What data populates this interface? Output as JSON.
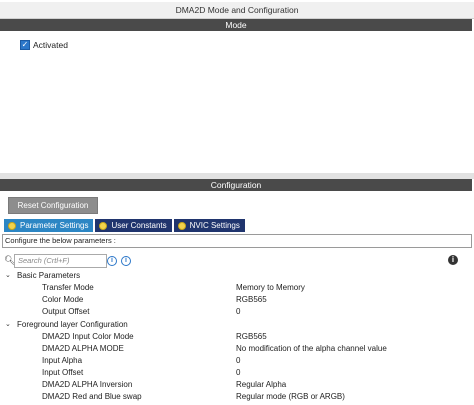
{
  "window": {
    "title": "DMA2D Mode and Configuration"
  },
  "mode": {
    "header": "Mode",
    "activated_label": "Activated",
    "activated_checked": true
  },
  "configuration": {
    "header": "Configuration",
    "reset_label": "Reset Configuration",
    "tabs": [
      {
        "label": "Parameter Settings",
        "active": true
      },
      {
        "label": "User Constants",
        "active": false
      },
      {
        "label": "NVIC Settings",
        "active": false
      }
    ],
    "description": "Configure the below parameters :",
    "search_placeholder": "Search (Crtl+F)",
    "groups": [
      {
        "name": "Basic Parameters",
        "params": [
          {
            "name": "Transfer Mode",
            "value": "Memory to Memory"
          },
          {
            "name": "Color Mode",
            "value": "RGB565"
          },
          {
            "name": "Output Offset",
            "value": "0"
          }
        ]
      },
      {
        "name": "Foreground layer Configuration",
        "params": [
          {
            "name": "DMA2D Input Color Mode",
            "value": "RGB565"
          },
          {
            "name": "DMA2D ALPHA MODE",
            "value": "No modification of the alpha channel value"
          },
          {
            "name": "Input Alpha",
            "value": "0"
          },
          {
            "name": "Input Offset",
            "value": "0"
          },
          {
            "name": "DMA2D ALPHA Inversion",
            "value": "Regular Alpha"
          },
          {
            "name": "DMA2D Red and Blue swap",
            "value": "Regular mode (RGB or ARGB)"
          }
        ]
      }
    ]
  },
  "colors": {
    "header_bar": "#4a4a4a",
    "tab_active": "#2c86c4",
    "tab_inactive": "#20356e",
    "checkbox": "#2c77c9"
  },
  "icons": [
    "check-icon",
    "search-icon",
    "info-icon",
    "expand-caret-icon"
  ]
}
